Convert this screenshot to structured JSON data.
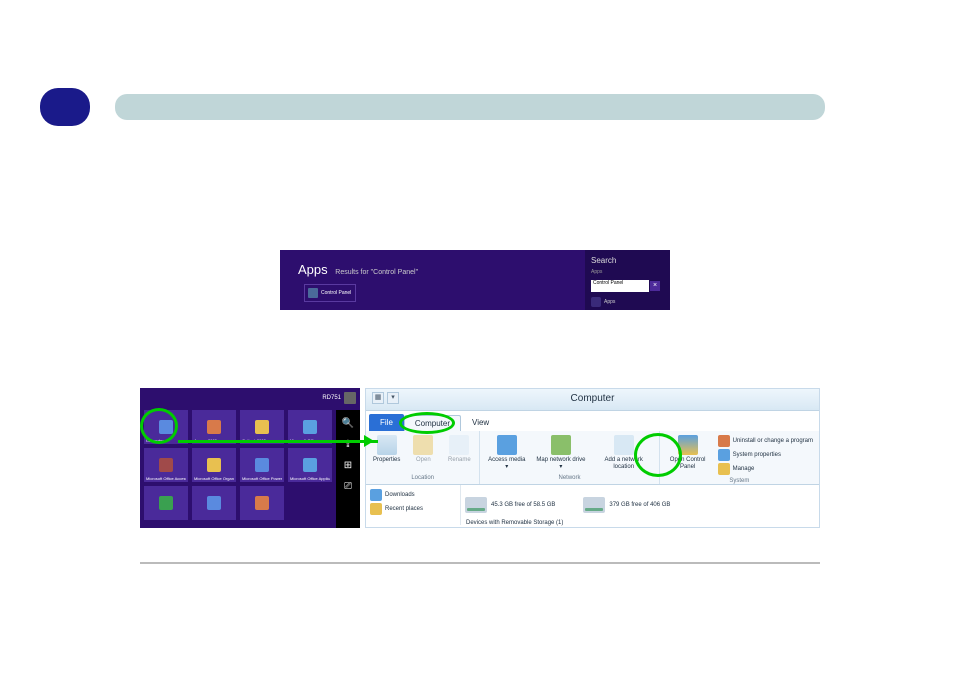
{
  "header": {},
  "fig1": {
    "title": "Apps",
    "sub": "Results for \"Control Panel\"",
    "tile_label": "Control Panel",
    "search_heading": "Search",
    "search_sub": "Apps",
    "search_value": "Control Panel",
    "close_char": "×",
    "apps_row_label": "Apps"
  },
  "start": {
    "user": "RD751",
    "tiles": [
      "Computer",
      "Access 2003",
      "Outlook 2003",
      "Microsoft Office...",
      "Microsoft Office Access Snapshot...",
      "Microsoft Office Organiza...",
      "Microsoft Office PowerPoint 2003",
      "Microsoft Office Application...",
      "",
      "",
      ""
    ]
  },
  "explorer": {
    "title": "Computer",
    "tabs": {
      "file": "File",
      "computer": "Computer",
      "view": "View"
    },
    "ribbon": {
      "location": {
        "label": "Location",
        "properties": "Properties",
        "open": "Open",
        "rename": "Rename"
      },
      "network": {
        "label": "Network",
        "access_media": "Access media ▾",
        "map_drive": "Map network drive ▾",
        "add_location": "Add a network location"
      },
      "system": {
        "label": "System",
        "open_control_panel": "Open Control Panel",
        "uninstall": "Uninstall or change a program",
        "sys_props": "System properties",
        "manage": "Manage"
      }
    },
    "nav": {
      "downloads": "Downloads",
      "recent_places": "Recent places"
    },
    "drives": [
      {
        "free": "45.3 GB free of 58.5 GB"
      },
      {
        "free": "379 GB free of 406 GB"
      }
    ],
    "footer": "Devices with Removable Storage (1)"
  }
}
